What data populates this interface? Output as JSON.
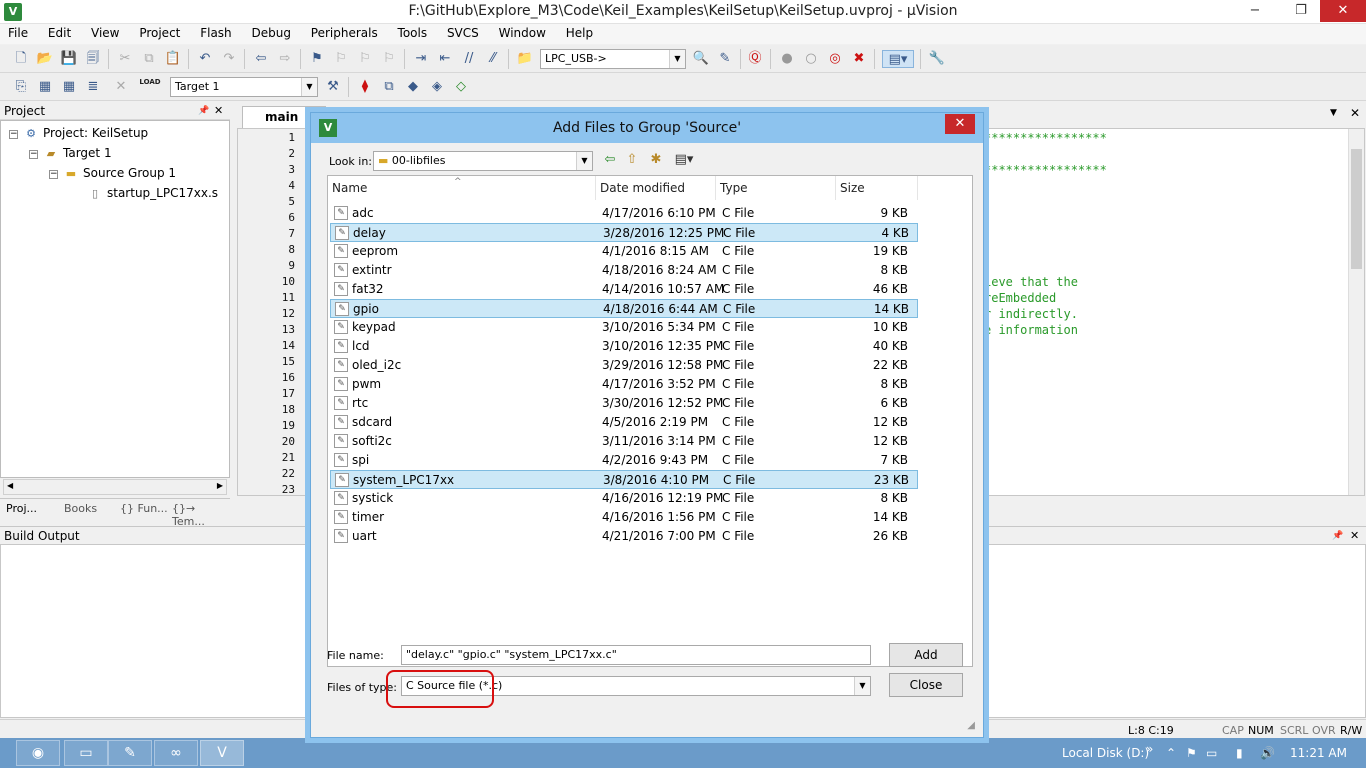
{
  "window": {
    "title": "F:\\GitHub\\Explore_M3\\Code\\Keil_Examples\\KeilSetup\\KeilSetup.uvproj - µVision",
    "app_icon_letter": "V",
    "min_glyph": "−",
    "restore_glyph": "❐",
    "close_glyph": "✕"
  },
  "menu": [
    "File",
    "Edit",
    "View",
    "Project",
    "Flash",
    "Debug",
    "Peripherals",
    "Tools",
    "SVCS",
    "Window",
    "Help"
  ],
  "toolbar1": {
    "combo_value": "LPC_USB->",
    "combo_arrow": "▼"
  },
  "toolbar2": {
    "load_label": "LOAD",
    "target_value": "Target 1",
    "combo_arrow": "▼"
  },
  "project_pane": {
    "title": "Project",
    "pin": "📌",
    "close": "✕",
    "tree": {
      "root": "Project: KeilSetup",
      "target": "Target 1",
      "group": "Source Group 1",
      "file": "startup_LPC17xx.s"
    },
    "tabs": [
      "Proj...",
      "Books",
      "{} Fun...",
      "{}→ Tem..."
    ]
  },
  "editor": {
    "tab_label": "main",
    "line_numbers": [
      "1",
      "2",
      "3",
      "4",
      "5",
      "6",
      "7",
      "8",
      "9",
      "10",
      "11",
      "12",
      "13",
      "14",
      "15",
      "16",
      "17",
      "18",
      "19",
      "20",
      "21",
      "22",
      "23"
    ],
    "visible_code": [
      "*****************",
      "*****************",
      "ieve that the",
      "reEmbedded",
      "r indirectly.",
      "e information"
    ]
  },
  "build_output": {
    "title": "Build Output"
  },
  "statusbar": {
    "position": "L:8 C:19",
    "indicators": [
      "CAP",
      "NUM",
      "SCRL",
      "OVR",
      "R/W"
    ]
  },
  "taskbar": {
    "local_disk": "Local Disk (D:)",
    "chevron": "»",
    "time": "11:21 AM"
  },
  "dialog": {
    "title": "Add Files to Group 'Source'",
    "close_glyph": "✕",
    "look_in_label": "Look in:",
    "look_in_value": "00-libfiles",
    "columns": {
      "name": "Name",
      "date": "Date modified",
      "type": "Type",
      "size": "Size"
    },
    "sort_glyph": "^",
    "files": [
      {
        "name": "adc",
        "date": "4/17/2016 6:10 PM",
        "type": "C File",
        "size": "9 KB",
        "selected": false
      },
      {
        "name": "delay",
        "date": "3/28/2016 12:25 PM",
        "type": "C File",
        "size": "4 KB",
        "selected": true
      },
      {
        "name": "eeprom",
        "date": "4/1/2016 8:15 AM",
        "type": "C File",
        "size": "19 KB",
        "selected": false
      },
      {
        "name": "extintr",
        "date": "4/18/2016 8:24 AM",
        "type": "C File",
        "size": "8 KB",
        "selected": false
      },
      {
        "name": "fat32",
        "date": "4/14/2016 10:57 AM",
        "type": "C File",
        "size": "46 KB",
        "selected": false
      },
      {
        "name": "gpio",
        "date": "4/18/2016 6:44 AM",
        "type": "C File",
        "size": "14 KB",
        "selected": true
      },
      {
        "name": "keypad",
        "date": "3/10/2016 5:34 PM",
        "type": "C File",
        "size": "10 KB",
        "selected": false
      },
      {
        "name": "lcd",
        "date": "3/10/2016 12:35 PM",
        "type": "C File",
        "size": "40 KB",
        "selected": false
      },
      {
        "name": "oled_i2c",
        "date": "3/29/2016 12:58 PM",
        "type": "C File",
        "size": "22 KB",
        "selected": false
      },
      {
        "name": "pwm",
        "date": "4/17/2016 3:52 PM",
        "type": "C File",
        "size": "8 KB",
        "selected": false
      },
      {
        "name": "rtc",
        "date": "3/30/2016 12:52 PM",
        "type": "C File",
        "size": "6 KB",
        "selected": false
      },
      {
        "name": "sdcard",
        "date": "4/5/2016 2:19 PM",
        "type": "C File",
        "size": "12 KB",
        "selected": false
      },
      {
        "name": "softi2c",
        "date": "3/11/2016 3:14 PM",
        "type": "C File",
        "size": "12 KB",
        "selected": false
      },
      {
        "name": "spi",
        "date": "4/2/2016 9:43 PM",
        "type": "C File",
        "size": "7 KB",
        "selected": false
      },
      {
        "name": "system_LPC17xx",
        "date": "3/8/2016 4:10 PM",
        "type": "C File",
        "size": "23 KB",
        "selected": true
      },
      {
        "name": "systick",
        "date": "4/16/2016 12:19 PM",
        "type": "C File",
        "size": "8 KB",
        "selected": false
      },
      {
        "name": "timer",
        "date": "4/16/2016 1:56 PM",
        "type": "C File",
        "size": "14 KB",
        "selected": false
      },
      {
        "name": "uart",
        "date": "4/21/2016 7:00 PM",
        "type": "C File",
        "size": "26 KB",
        "selected": false
      }
    ],
    "file_name_label": "File name:",
    "file_name_value": "\"delay.c\" \"gpio.c\" \"system_LPC17xx.c\"",
    "file_type_label": "Files of type:",
    "file_type_value": "C Source file (*.c)",
    "add_label": "Add",
    "close_label": "Close",
    "combo_arrow": "▼"
  },
  "colors": {
    "dialog_title": "#8dc3ee",
    "selection": "#cce8f7",
    "highlight_circle": "#d80f0f",
    "taskbar": "#6b9bc9",
    "code_comment": "#2a9a2a"
  }
}
